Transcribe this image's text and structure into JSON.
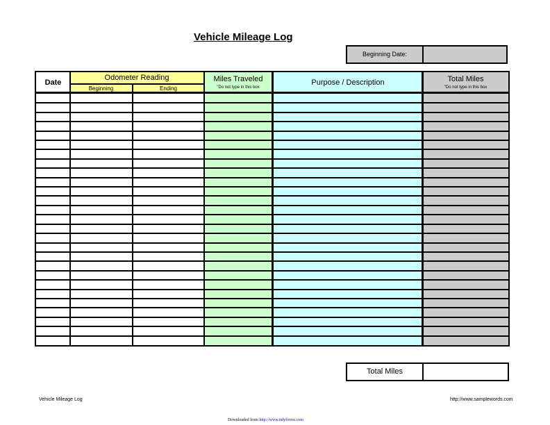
{
  "document": {
    "title": "Vehicle Mileage Log"
  },
  "beginning_date": {
    "label": "Beginning Date:",
    "value": ""
  },
  "log_table": {
    "columns": {
      "date": {
        "label": "Date"
      },
      "odometer": {
        "label": "Odometer Reading",
        "beginning": "Beginning",
        "ending": "Ending"
      },
      "miles_traveled": {
        "label": "Miles Traveled",
        "note": "\"Do not type in this box"
      },
      "purpose": {
        "label": "Purpose / Description"
      },
      "total_miles": {
        "label": "Total Miles",
        "note": "\"Do not type in this box"
      }
    },
    "row_count": 27,
    "colors": {
      "odometer_header": "#ffff99",
      "miles_traveled": "#ccffcc",
      "purpose": "#ccffff",
      "total_miles": "#cccccc"
    }
  },
  "total_miles_summary": {
    "label": "Total Miles",
    "value": ""
  },
  "footer": {
    "left": "Vehicle Mileage Log",
    "right": "http://www.samplewords.com",
    "download_prefix": "Downloaded from",
    "download_link": "http://www.tidyforms.com"
  }
}
